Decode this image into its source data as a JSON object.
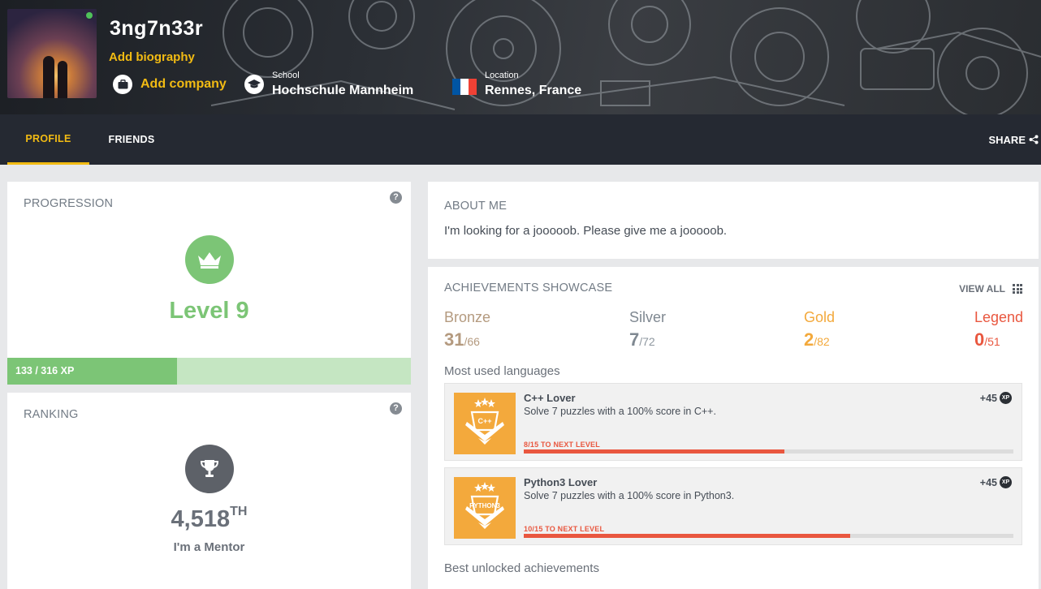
{
  "profile": {
    "username": "3ng7n33r",
    "add_biography": "Add biography",
    "add_company": "Add company",
    "school_label": "School",
    "school_value": "Hochschule Mannheim",
    "location_label": "Location",
    "location_value": "Rennes, France",
    "flag_colors": [
      "#0055a4",
      "#ffffff",
      "#ef4135"
    ]
  },
  "nav": {
    "tabs": [
      {
        "label": "PROFILE",
        "active": true
      },
      {
        "label": "FRIENDS",
        "active": false
      }
    ],
    "share": "SHARE"
  },
  "progression": {
    "title": "PROGRESSION",
    "help": "?",
    "level": "Level 9",
    "xp_text": "133 / 316 XP",
    "xp_current": 133,
    "xp_total": 316
  },
  "ranking": {
    "title": "RANKING",
    "help": "?",
    "rank": "4,518",
    "rank_suffix": "TH",
    "subtitle": "I'm a Mentor"
  },
  "about": {
    "title": "ABOUT ME",
    "text": "I'm looking for a jooooob. Please give me a jooooob."
  },
  "achievements": {
    "title": "ACHIEVEMENTS SHOWCASE",
    "view_all": "VIEW ALL",
    "tiers": [
      {
        "name": "Bronze",
        "count": "31",
        "total": "/66",
        "color": "#b49a7f",
        "total_color": "#b49a7f"
      },
      {
        "name": "Silver",
        "count": "7",
        "total": "/72",
        "color": "#7f8891",
        "total_color": "#8e979f"
      },
      {
        "name": "Gold",
        "count": "2",
        "total": "/82",
        "color": "#f3a93c",
        "total_color": "#f3a93c"
      },
      {
        "name": "Legend",
        "count": "0",
        "total": "/51",
        "color": "#e9573f",
        "total_color": "#e9573f"
      }
    ],
    "most_used_label": "Most used languages",
    "items": [
      {
        "title": "C++ Lover",
        "description": "Solve 7 puzzles with a 100% score in C++.",
        "xp": "+45",
        "xp_icon": "XP",
        "next": "8/15 TO NEXT LEVEL",
        "progress": 0.533,
        "badge_text": "C++"
      },
      {
        "title": "Python3 Lover",
        "description": "Solve 7 puzzles with a 100% score in Python3.",
        "xp": "+45",
        "xp_icon": "XP",
        "next": "10/15 TO NEXT LEVEL",
        "progress": 0.667,
        "badge_text": "PYTHON3"
      }
    ],
    "best_unlocked_label": "Best unlocked achievements"
  }
}
